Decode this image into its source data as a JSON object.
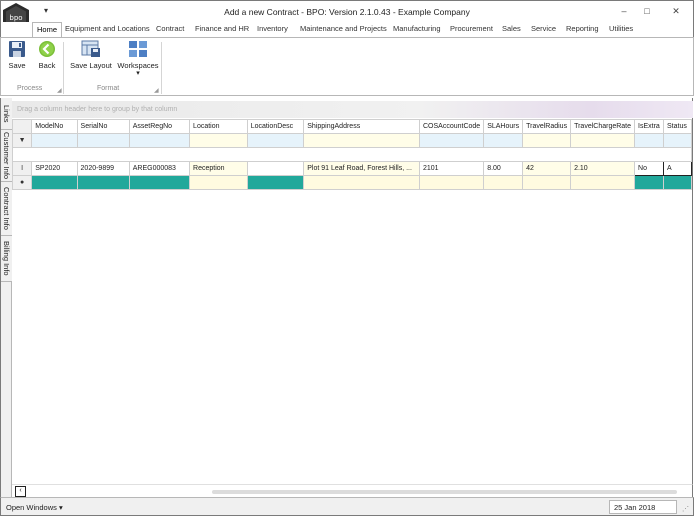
{
  "window": {
    "title": "Add a new Contract - BPO: Version 2.1.0.43 - Example Company",
    "qat_glyph": "▾",
    "minimize": "–",
    "maximize": "□",
    "close": "✕"
  },
  "tabs": [
    {
      "label": "Home",
      "active": true
    },
    {
      "label": "Equipment and Locations"
    },
    {
      "label": "Contract"
    },
    {
      "label": "Finance and HR"
    },
    {
      "label": "Inventory"
    },
    {
      "label": "Maintenance and Projects"
    },
    {
      "label": "Manufacturing"
    },
    {
      "label": "Procurement"
    },
    {
      "label": "Sales"
    },
    {
      "label": "Service"
    },
    {
      "label": "Reporting"
    },
    {
      "label": "Utilities"
    }
  ],
  "ribbon": {
    "save": "Save",
    "back": "Back",
    "process_group": "Process",
    "save_layout": "Save Layout",
    "workspaces": "Workspaces",
    "format_group": "Format",
    "dropdown_glyph": "▾",
    "launcher_glyph": "◢"
  },
  "side_tabs": [
    "Links",
    "Customer Info",
    "Contract Info",
    "Billing Info"
  ],
  "grid": {
    "group_hint": "Drag a column header here to group by that column",
    "columns": [
      "ModelNo",
      "SerialNo",
      "AssetRegNo",
      "Location",
      "LocationDesc",
      "ShippingAddress",
      "COSAccountCode",
      "SLAHours",
      "TravelRadius",
      "TravelChargeRate",
      "IsExtra",
      "Status"
    ],
    "filter_glyph": "▼",
    "data_indicator": "I",
    "new_indicator": "●",
    "row": {
      "ModelNo": "SP2020",
      "SerialNo": "2020-9899",
      "AssetRegNo": "AREG000083",
      "Location": "Reception",
      "LocationDesc": "",
      "ShippingAddress": "Plot 91 Leaf Road, Forest Hills, ...",
      "COSAccountCode": "2101",
      "SLAHours": "8.00",
      "TravelRadius": "42",
      "TravelChargeRate": "2.10",
      "IsExtra": "No",
      "Status": "A"
    }
  },
  "scroll": {
    "left_glyph": "‹"
  },
  "status": {
    "open_windows": "Open Windows ▾",
    "date": "25 Jan 2018"
  },
  "colors": {
    "new_row": "#21a89b",
    "filter_row": "#e6f3fb",
    "editable": "#fffde8"
  }
}
